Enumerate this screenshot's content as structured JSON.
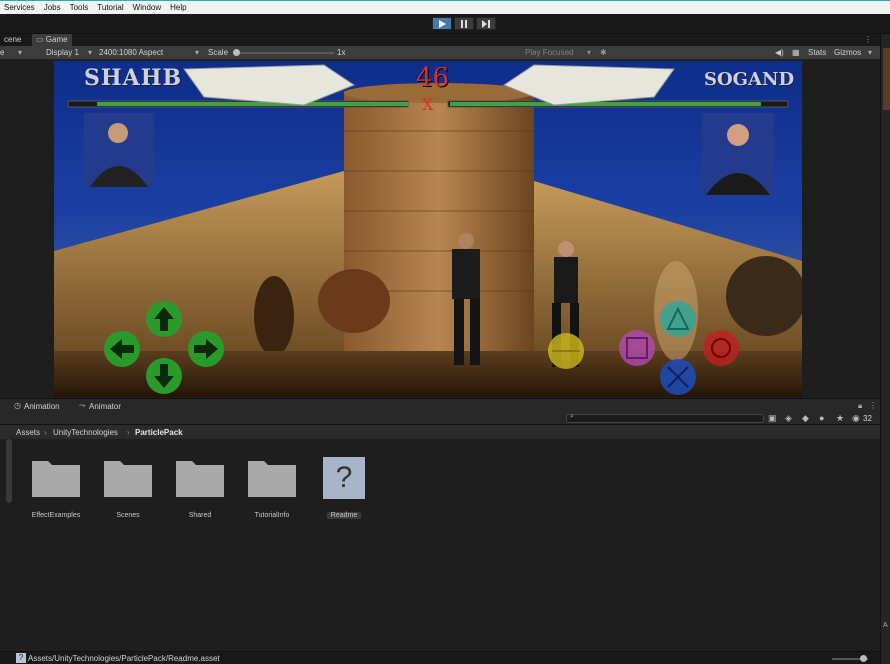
{
  "menu": [
    "Services",
    "Jobs",
    "Tools",
    "Tutorial",
    "Window",
    "Help"
  ],
  "tabs": {
    "scene": "cene",
    "game": "Game"
  },
  "game_toolbar": {
    "mode": "e",
    "display": "Display 1",
    "aspect": "2400:1080 Aspect",
    "scale_label": "Scale",
    "scale_value": "1x",
    "play_focused": "Play Focused",
    "stats": "Stats",
    "gizmos": "Gizmos"
  },
  "game": {
    "player1_name": "SHAHB",
    "player2_name": "SOGAND",
    "timer": "46",
    "vs": "X",
    "p1_health": 0.92,
    "p2_health": 0.92
  },
  "bottom_tabs": [
    "Animation",
    "Animator"
  ],
  "breadcrumb": [
    "Assets",
    "UnityTechnologies",
    "ParticlePack"
  ],
  "asset_count": "32",
  "assets": [
    {
      "name": "EffectExamples",
      "type": "folder"
    },
    {
      "name": "Scenes",
      "type": "folder"
    },
    {
      "name": "Shared",
      "type": "folder"
    },
    {
      "name": "TutorialInfo",
      "type": "folder"
    },
    {
      "name": "Readme",
      "type": "asset"
    }
  ],
  "status_path": "Assets/UnityTechnologies/ParticlePack/Readme.asset",
  "colors": {
    "accent": "#4678b0",
    "sky": "#1b3fa3",
    "health": "#3fa33f",
    "dpad": "#2a9a2a"
  }
}
